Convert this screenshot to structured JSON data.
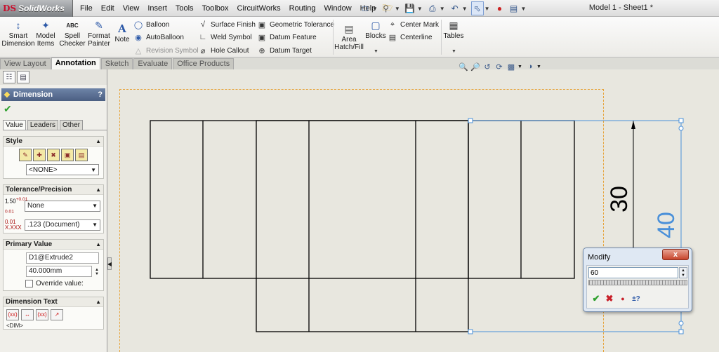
{
  "app": {
    "logo_ds": "DS",
    "logo_name": "SolidWorks",
    "document_title": "Model 1 - Sheet1 *"
  },
  "menu": [
    "File",
    "Edit",
    "View",
    "Insert",
    "Tools",
    "Toolbox",
    "CircuitWorks",
    "Routing",
    "Window",
    "Help"
  ],
  "ribbon": {
    "smart_dimension": [
      "Smart",
      "Dimension"
    ],
    "model_items": [
      "Model",
      "Items"
    ],
    "spell_checker": [
      "Spell",
      "Checker"
    ],
    "format_painter": [
      "Format",
      "Painter"
    ],
    "note": "Note",
    "balloon": "Balloon",
    "autoballoon": "AutoBalloon",
    "revision_symbol": "Revision Symbol",
    "surface_finish": "Surface Finish",
    "weld_symbol": "Weld Symbol",
    "hole_callout": "Hole Callout",
    "geometric_tolerance": "Geometric Tolerance",
    "datum_feature": "Datum Feature",
    "datum_target": "Datum Target",
    "area_hatch": [
      "Area",
      "Hatch/Fill"
    ],
    "blocks": "Blocks",
    "center_mark": "Center Mark",
    "centerline": "Centerline",
    "tables": "Tables"
  },
  "tabs": [
    "View Layout",
    "Annotation",
    "Sketch",
    "Evaluate",
    "Office Products"
  ],
  "active_tab": "Annotation",
  "property_manager": {
    "title": "Dimension",
    "help": "?",
    "tabs": [
      "Value",
      "Leaders",
      "Other"
    ],
    "style": {
      "header": "Style",
      "selection": "<NONE>"
    },
    "tolerance": {
      "header": "Tolerance/Precision",
      "tolerance_icon": [
        "1.50",
        "+0.01",
        "-0.01"
      ],
      "tolerance_type": "None",
      "precision_icon": [
        "0.01",
        "X.XXX"
      ],
      "precision": ".123 (Document)"
    },
    "primary_value": {
      "header": "Primary Value",
      "name": "D1@Extrude2",
      "value": "40.000mm",
      "override_label": "Override value:"
    },
    "dimension_text": {
      "header": "Dimension Text",
      "text": "<DIM>"
    }
  },
  "drawing": {
    "dim_30": "30",
    "dim_40": "40"
  },
  "modify_dialog": {
    "title": "Modify",
    "close": "x",
    "value": "60"
  },
  "colors": {
    "sheet_border": "#e6a43b",
    "selected_dimension": "#4a90d9",
    "line": "#000000"
  }
}
